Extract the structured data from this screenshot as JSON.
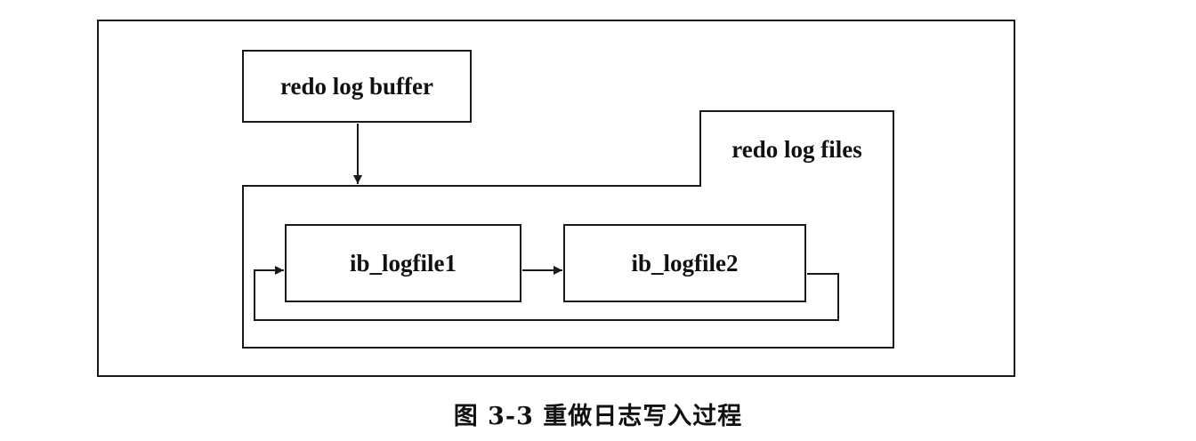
{
  "diagram": {
    "buffer_label": "redo log buffer",
    "files_label": "redo log files",
    "logfile1_label": "ib_logfile1",
    "logfile2_label": "ib_logfile2"
  },
  "caption": "图 3-3   重做日志写入过程"
}
